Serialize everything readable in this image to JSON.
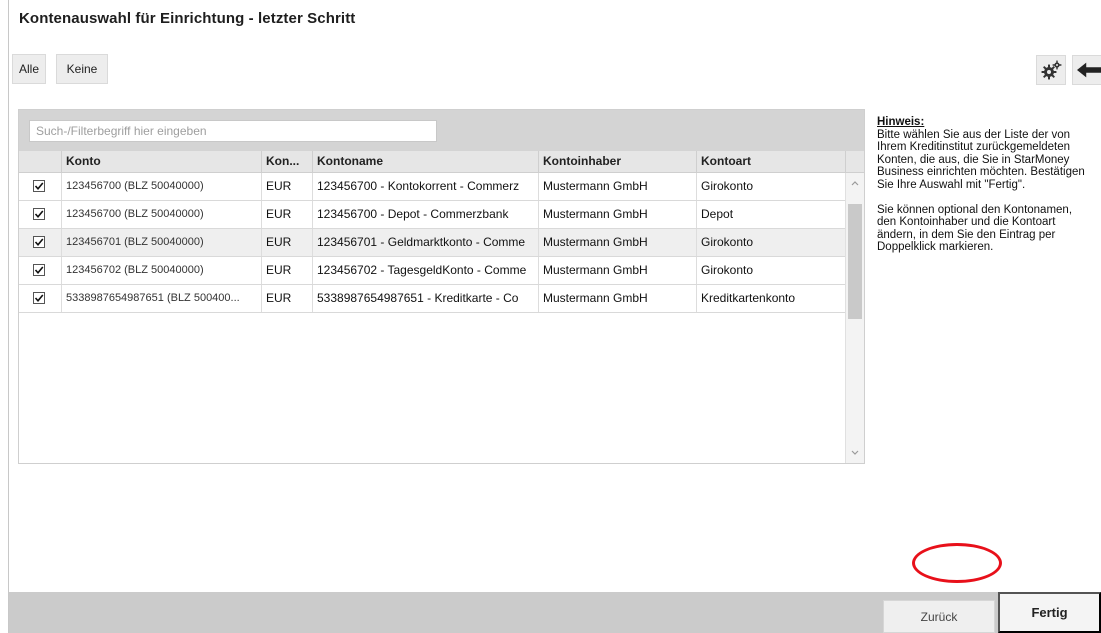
{
  "window": {
    "title": "Kontenauswahl für Einrichtung - letzter Schritt"
  },
  "toolbar": {
    "all_label": "Alle",
    "none_label": "Keine"
  },
  "search": {
    "placeholder": "Such-/Filterbegriff hier eingeben",
    "value": ""
  },
  "table": {
    "columns": [
      "Konto",
      "Kon...",
      "Kontoname",
      "Kontoinhaber",
      "Kontoart"
    ],
    "rows": [
      {
        "checked": true,
        "konto": "123456700 (BLZ 50040000)",
        "waehrung": "EUR",
        "kontoname": "123456700 - Kontokorrent - Commerz",
        "inhaber": "Mustermann GmbH",
        "kontoart": "Girokonto"
      },
      {
        "checked": true,
        "konto": "123456700 (BLZ 50040000)",
        "waehrung": "EUR",
        "kontoname": "123456700 - Depot - Commerzbank",
        "inhaber": "Mustermann GmbH",
        "kontoart": "Depot"
      },
      {
        "checked": true,
        "konto": "123456701 (BLZ 50040000)",
        "waehrung": "EUR",
        "kontoname": "123456701 - Geldmarktkonto - Comme",
        "inhaber": "Mustermann GmbH",
        "kontoart": "Girokonto"
      },
      {
        "checked": true,
        "konto": "123456702 (BLZ 50040000)",
        "waehrung": "EUR",
        "kontoname": "123456702 - TagesgeldKonto - Comme",
        "inhaber": "Mustermann GmbH",
        "kontoart": "Girokonto"
      },
      {
        "checked": true,
        "konto": "5338987654987651 (BLZ 500400...",
        "waehrung": "EUR",
        "kontoname": "5338987654987651 - Kreditkarte - Co",
        "inhaber": "Mustermann GmbH",
        "kontoart": "Kreditkartenkonto"
      }
    ]
  },
  "hint": {
    "heading": "Hinweis:",
    "paragraph1": "Bitte wählen Sie aus der Liste der von Ihrem Kreditinstitut zurückgemeldeten Konten, die aus, die Sie in StarMoney Business einrichten möchten. Bestätigen Sie Ihre Auswahl mit \"Fertig\".",
    "paragraph2": "Sie können optional den Kontonamen, den Kontoinhaber und die Kontoart ändern, in dem Sie den Eintrag per Doppelklick markieren."
  },
  "footer": {
    "back_label": "Zurück",
    "finish_label": "Fertig"
  },
  "icons": {
    "settings": "gears-icon",
    "navigate_back": "arrow-left-icon",
    "check": "checkmark-icon"
  },
  "colors": {
    "highlight": "#e8101a",
    "bar": "#cbcbcb",
    "header": "#e6e6e6",
    "band": "#d4d4d4"
  }
}
